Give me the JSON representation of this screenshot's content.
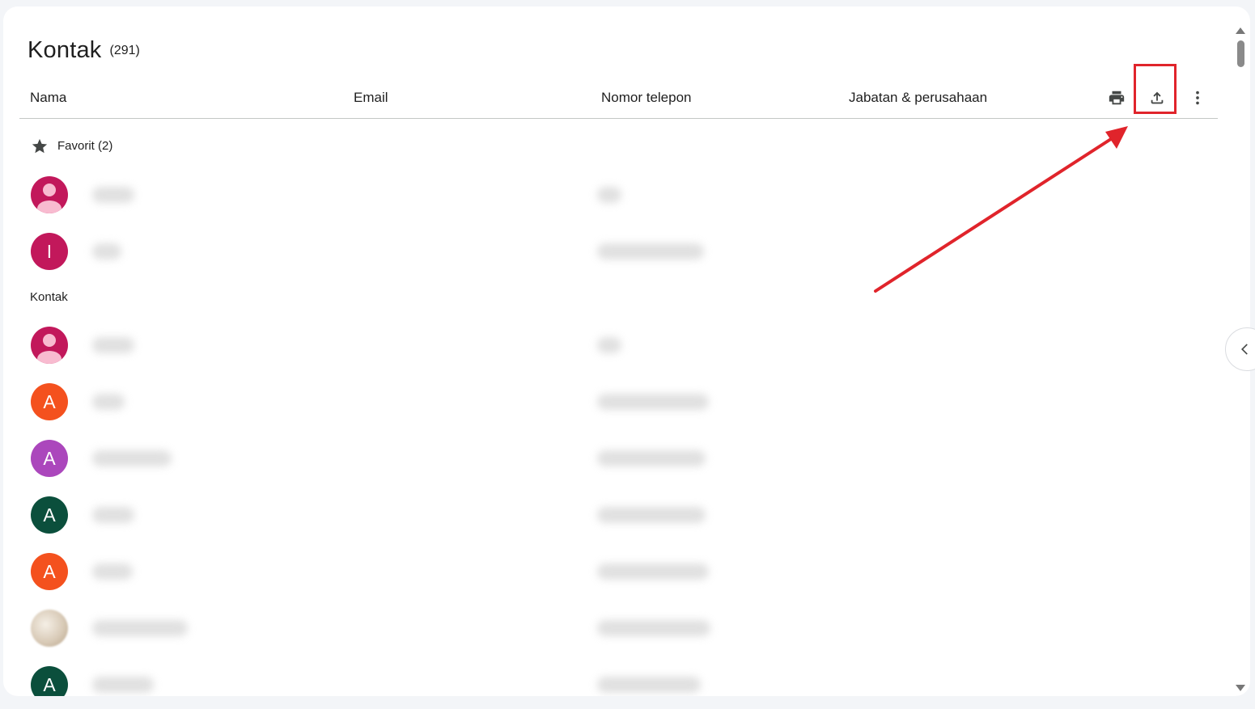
{
  "page": {
    "title": "Kontak",
    "count": "(291)"
  },
  "columns": {
    "name": "Nama",
    "email": "Email",
    "phone": "Nomor telepon",
    "job": "Jabatan & perusahaan"
  },
  "toolbar": {
    "print_icon": "print-icon",
    "export_icon": "export-upload-icon",
    "more_icon": "more-vert-icon"
  },
  "sections": {
    "favorites": "Favorit (2)",
    "contacts": "Kontak"
  },
  "favorites": [
    {
      "avatar_type": "person",
      "initial": "",
      "color": "#c2185b"
    },
    {
      "avatar_type": "letter",
      "initial": "I",
      "color": "#c2185b"
    }
  ],
  "contacts": [
    {
      "avatar_type": "person",
      "initial": "",
      "color": "#c2185b"
    },
    {
      "avatar_type": "letter",
      "initial": "A",
      "color": "#f4511e"
    },
    {
      "avatar_type": "letter",
      "initial": "A",
      "color": "#ab47bc"
    },
    {
      "avatar_type": "letter",
      "initial": "A",
      "color": "#0b4f3c"
    },
    {
      "avatar_type": "letter",
      "initial": "A",
      "color": "#f4511e"
    },
    {
      "avatar_type": "photo",
      "initial": "",
      "color": "#d9cbb8"
    },
    {
      "avatar_type": "letter",
      "initial": "A",
      "color": "#0b4f3c"
    }
  ],
  "annotation": {
    "color": "#e0242b"
  }
}
